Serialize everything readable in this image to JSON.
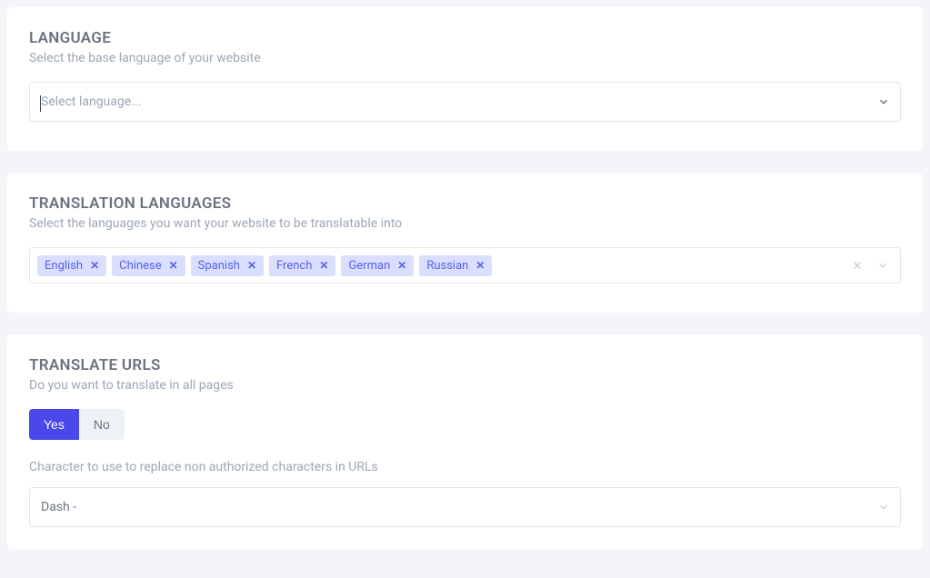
{
  "language": {
    "title": "LANGUAGE",
    "subtitle": "Select the base language of your website",
    "placeholder": "Select language..."
  },
  "translation_languages": {
    "title": "TRANSLATION LANGUAGES",
    "subtitle": "Select the languages you want your website to be translatable into",
    "tags": [
      "English",
      "Chinese",
      "Spanish",
      "French",
      "German",
      "Russian"
    ]
  },
  "translate_urls": {
    "title": "TRANSLATE URLS",
    "subtitle": "Do you want to translate in all pages",
    "yes": "Yes",
    "no": "No",
    "active": "yes",
    "character_label": "Character to use to replace non authorized characters in URLs",
    "character_value": "Dash -"
  }
}
